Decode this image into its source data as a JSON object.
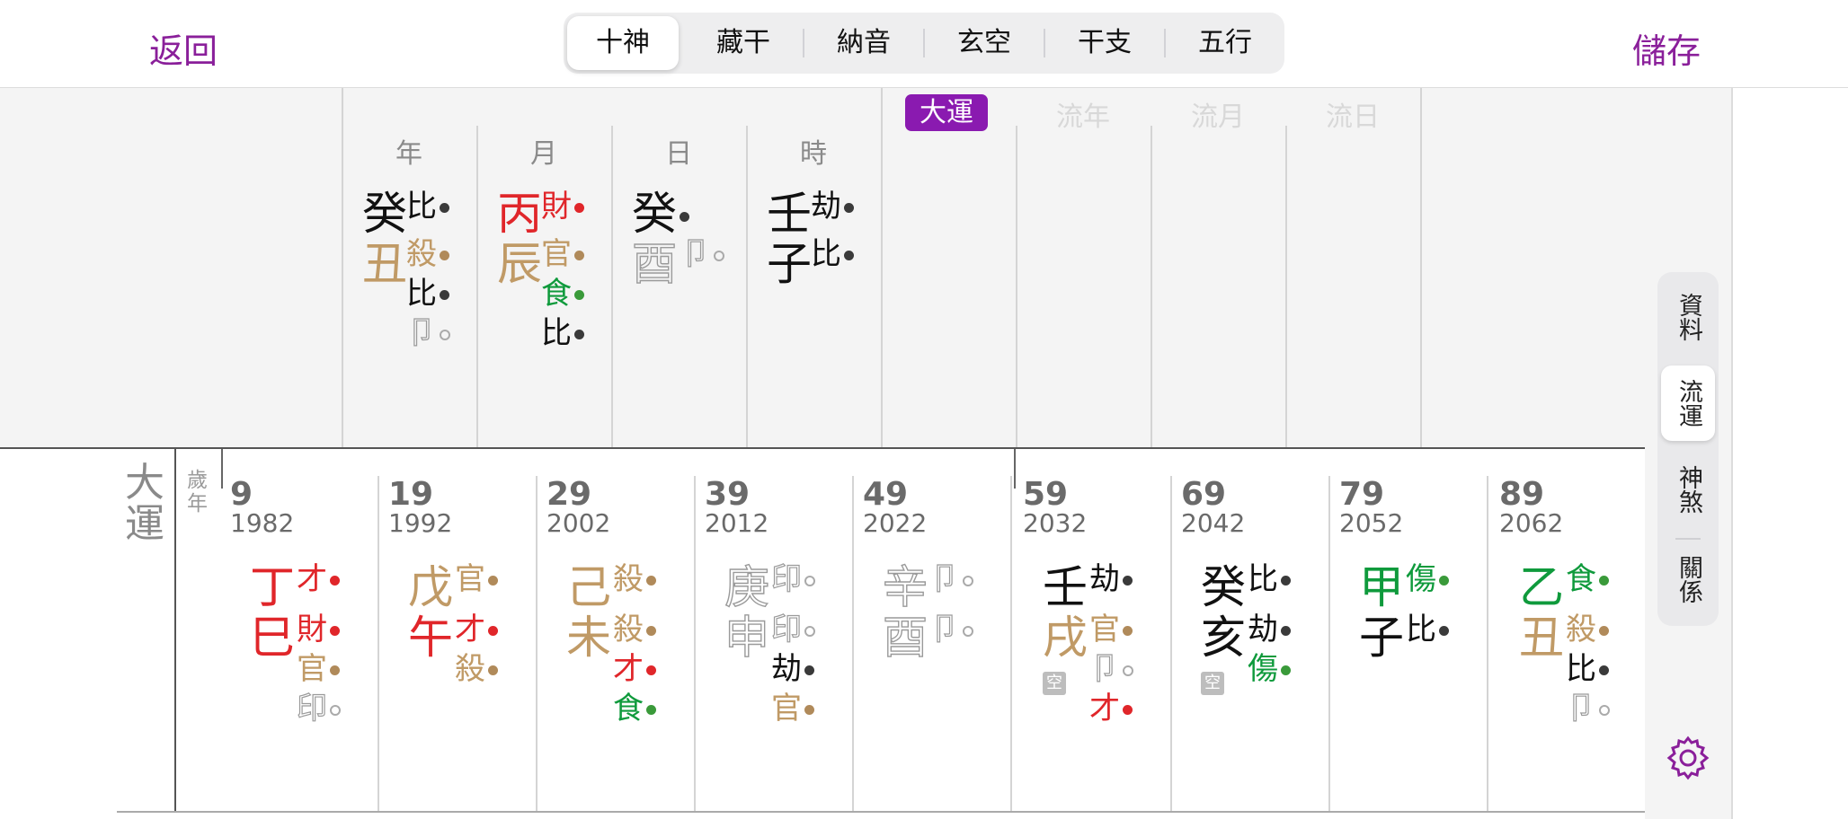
{
  "header": {
    "back_label": "返回",
    "save_label": "儲存",
    "tabs": [
      "十神",
      "藏干",
      "納音",
      "玄空",
      "干支",
      "五行"
    ],
    "selected_tab": 0
  },
  "pillars": {
    "headers": [
      "年",
      "月",
      "日",
      "時"
    ],
    "extra_headers": [
      "大運",
      "流年",
      "流月",
      "流日"
    ],
    "items": [
      {
        "stem": "癸",
        "stem_god": "比",
        "branch": "丑",
        "hidden": [
          "殺",
          "比",
          "卩"
        ]
      },
      {
        "stem": "丙",
        "stem_god": "財",
        "branch": "辰",
        "hidden": [
          "官",
          "食",
          "比"
        ]
      },
      {
        "stem": "癸",
        "stem_god": "",
        "branch": "酉",
        "hidden": [
          "卩"
        ]
      },
      {
        "stem": "壬",
        "stem_god": "劫",
        "branch": "子",
        "hidden": [
          "比"
        ]
      }
    ]
  },
  "dayun": {
    "label": "大運",
    "age_label": "歲",
    "year_label": "年",
    "kong_label": "空",
    "items": [
      {
        "age": "9",
        "year": "1982",
        "stem": "丁",
        "stem_god": "才",
        "branch": "巳",
        "hidden": [
          "財",
          "官",
          "印"
        ]
      },
      {
        "age": "19",
        "year": "1992",
        "stem": "戊",
        "stem_god": "官",
        "branch": "午",
        "hidden": [
          "才",
          "殺"
        ]
      },
      {
        "age": "29",
        "year": "2002",
        "stem": "己",
        "stem_god": "殺",
        "branch": "未",
        "hidden": [
          "殺",
          "才",
          "食"
        ]
      },
      {
        "age": "39",
        "year": "2012",
        "stem": "庚",
        "stem_god": "印",
        "branch": "申",
        "hidden": [
          "印",
          "劫",
          "官"
        ]
      },
      {
        "age": "49",
        "year": "2022",
        "stem": "辛",
        "stem_god": "卩",
        "branch": "酉",
        "hidden": [
          "卩"
        ]
      },
      {
        "age": "59",
        "year": "2032",
        "stem": "壬",
        "stem_god": "劫",
        "branch": "戌",
        "hidden": [
          "官",
          "卩",
          "才"
        ],
        "kong": true
      },
      {
        "age": "69",
        "year": "2042",
        "stem": "癸",
        "stem_god": "比",
        "branch": "亥",
        "hidden": [
          "劫",
          "傷"
        ],
        "kong": true
      },
      {
        "age": "79",
        "year": "2052",
        "stem": "甲",
        "stem_god": "傷",
        "branch": "子",
        "hidden": [
          "比"
        ]
      },
      {
        "age": "89",
        "year": "2062",
        "stem": "乙",
        "stem_god": "食",
        "branch": "丑",
        "hidden": [
          "殺",
          "比",
          "卩"
        ]
      }
    ]
  },
  "side_panel": {
    "items": [
      "資料",
      "流運",
      "神煞",
      "關係"
    ],
    "selected": 1
  },
  "colors": {
    "accent": "#8a1f9a",
    "fire_red": "#e0262a",
    "earth_tan": "#c09a66",
    "wood_green": "#0f9a3c",
    "water_black": "#111111",
    "metal_outline": "#9a9a9a"
  },
  "icons": {
    "settings": "gear-icon"
  }
}
